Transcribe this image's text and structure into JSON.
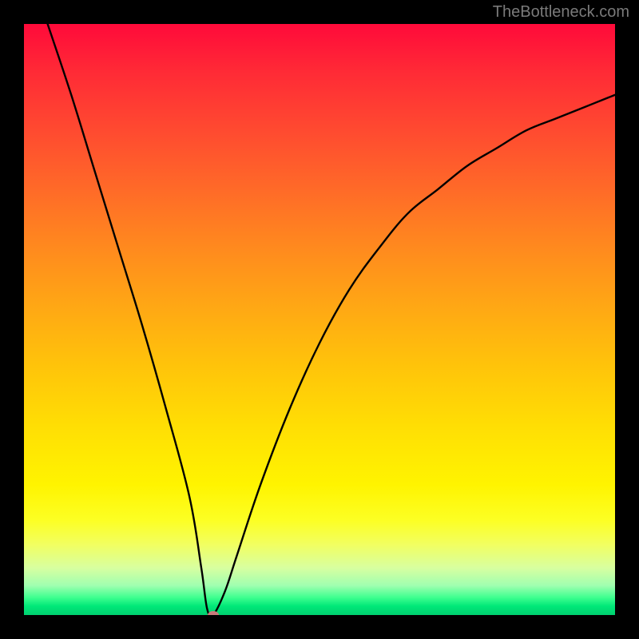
{
  "watermark": "TheBottleneck.com",
  "chart_data": {
    "type": "line",
    "title": "",
    "xlabel": "",
    "ylabel": "",
    "xlim": [
      0,
      100
    ],
    "ylim": [
      0,
      100
    ],
    "grid": false,
    "series": [
      {
        "name": "bottleneck-curve",
        "x": [
          4,
          8,
          12,
          16,
          20,
          24,
          28,
          30,
          31,
          32,
          34,
          36,
          40,
          45,
          50,
          55,
          60,
          65,
          70,
          75,
          80,
          85,
          90,
          95,
          100
        ],
        "values": [
          100,
          88,
          75,
          62,
          49,
          35,
          20,
          8,
          1,
          0,
          4,
          10,
          22,
          35,
          46,
          55,
          62,
          68,
          72,
          76,
          79,
          82,
          84,
          86,
          88
        ]
      }
    ],
    "minimum_point": {
      "x": 32,
      "y": 0
    },
    "bottom_band": {
      "yellow_white_start": 78,
      "green_start": 96
    }
  }
}
